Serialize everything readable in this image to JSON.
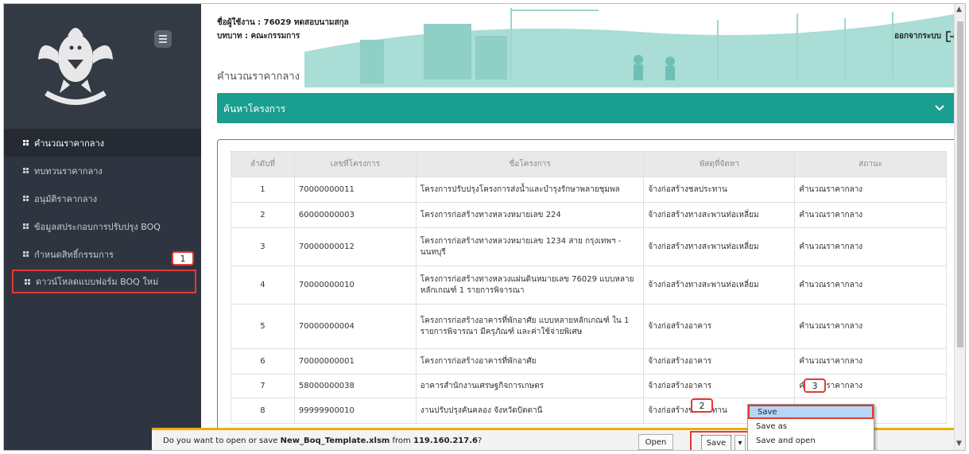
{
  "app": {
    "logo_alt": "กรมบัญชีกลาง"
  },
  "sidebar": {
    "items": [
      {
        "label": "คำนวณราคากลาง"
      },
      {
        "label": "ทบทวนราคากลาง"
      },
      {
        "label": "อนุมัติราคากลาง"
      },
      {
        "label": "ข้อมูลสประกอบการปรับปรุง BOQ"
      },
      {
        "label": "กำหนดสิทธิ์กรรมการ"
      },
      {
        "label": "ดาวน์โหลดแบบฟอร์ม BOQ ใหม่"
      }
    ]
  },
  "header": {
    "user": "ชื่อผู้ใช้งาน : 76029 ทดสอบนามสกุล",
    "role": "บทบาท : คณะกรรมการ",
    "page_title": "คำนวณราคากลาง",
    "logout_label": "ออกจากระบบ"
  },
  "search_panel": {
    "title": "ค้นหาโครงการ"
  },
  "table": {
    "headers": [
      "ลำดับที่",
      "เลขที่โครงการ",
      "ชื่อโครงการ",
      "พัสดุที่จัดหา",
      "สถานะ"
    ],
    "rows": [
      [
        "1",
        "70000000011",
        "โครงการปรับปรุงโครงการส่งน้ำและบำรุงรักษาพลายชุมพล",
        "จ้างก่อสร้างชลประทาน",
        "คำนวณราคากลาง"
      ],
      [
        "2",
        "60000000003",
        "โครงการก่อสร้างทางหลวงหมายเลข 224",
        "จ้างก่อสร้างทางสะพานท่อเหลี่ยม",
        "คำนวณราคากลาง"
      ],
      [
        "3",
        "70000000012",
        "โครงการก่อสร้างทางหลวงหมายเลข 1234 สาย กรุงเทพฯ - นนทบุรี",
        "จ้างก่อสร้างทางสะพานท่อเหลี่ยม",
        "คำนวณราคากลาง"
      ],
      [
        "4",
        "70000000010",
        "โครงการก่อสร้างทางหลวงแผ่นดินหมายเลข 76029 แบบหลายหลักเกณฑ์ 1 รายการพิจารณา",
        "จ้างก่อสร้างทางสะพานท่อเหลี่ยม",
        "คำนวณราคากลาง"
      ],
      [
        "5",
        "70000000004",
        "โครงการก่อสร้างอาคารที่พักอาศัย แบบหลายหลักเกณฑ์ ใน 1 รายการพิจารณา มีครุภัณฑ์ และค่าใช้จ่ายพิเศษ",
        "จ้างก่อสร้างอาคาร",
        "คำนวณราคากลาง"
      ],
      [
        "6",
        "70000000001",
        "โครงการก่อสร้างอาคารที่พักอาศัย",
        "จ้างก่อสร้างอาคาร",
        "คำนวณราคากลาง"
      ],
      [
        "7",
        "58000000038",
        "อาคารสำนักงานเศรษฐกิจการเกษตร",
        "จ้างก่อสร้างอาคาร",
        "คำนวณราคากลาง"
      ],
      [
        "8",
        "99999900010",
        "งานปรับปรุงคันคลอง จังหวัดปัตตานี",
        "จ้างก่อสร้างชลประทาน",
        ""
      ]
    ]
  },
  "download_bar": {
    "prompt_prefix": "Do you want to open or save ",
    "filename": "New_Boq_Template.xlsm",
    "prompt_mid": " from ",
    "host": "119.160.217.6",
    "prompt_suffix": "?",
    "open_label": "Open",
    "save_label": "Save",
    "dropdown_glyph": "▾"
  },
  "context_menu": {
    "items": [
      "Save",
      "Save as",
      "Save and open"
    ]
  },
  "callouts": [
    "1",
    "2",
    "3"
  ],
  "colors": {
    "sidebar_bg": "#2f3540",
    "accent_teal": "#1a9e8f",
    "highlight_red": "#e53935",
    "download_accent": "#f0ad00"
  }
}
